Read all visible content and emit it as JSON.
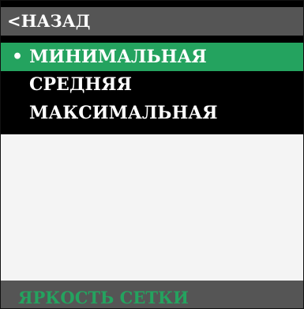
{
  "menu": {
    "back_label": "<НАЗАД",
    "items": [
      {
        "bullet": "•",
        "label": "МИНИМАЛЬНАЯ",
        "selected": true
      },
      {
        "label": "СРЕДНЯЯ",
        "selected": false
      },
      {
        "label": "МАКСИМАЛЬНАЯ",
        "selected": false
      }
    ]
  },
  "footer": {
    "title": "ЯРКОСТЬ СЕТКИ"
  },
  "colors": {
    "panel_background": "#000000",
    "back_row_background": "#555555",
    "selected_background": "#24a35f",
    "menu_text": "#ffffff",
    "content_background": "#f4f4f4",
    "footer_background": "#555555",
    "footer_text": "#24a35f"
  }
}
